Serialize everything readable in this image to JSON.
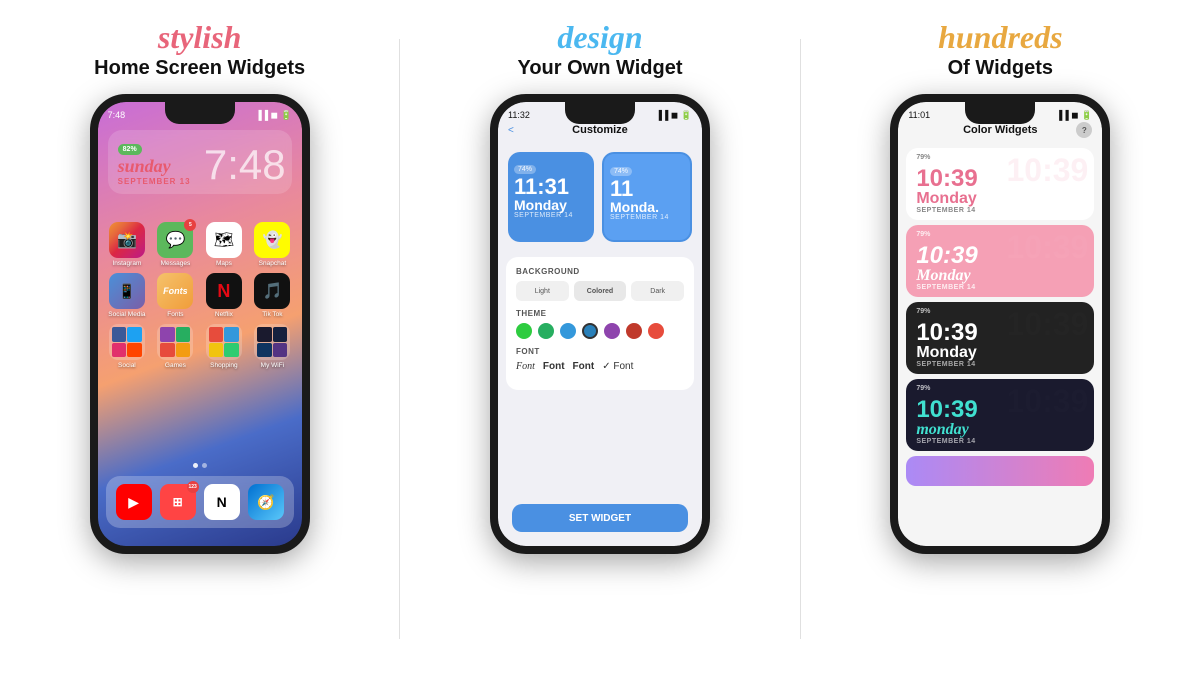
{
  "panels": [
    {
      "id": "panel1",
      "title_cursive": "stylish",
      "title_cursive_color": "pink",
      "title_bold": "Home Screen Widgets",
      "phone": {
        "time": "7:48",
        "status_left": "7:48",
        "status_right": "...",
        "battery": "82%",
        "clock_day": "sunday",
        "clock_time": "7:48",
        "clock_date": "SEPTEMBER 13",
        "apps": [
          {
            "name": "Instagram",
            "label": "Instagram",
            "color": "insta",
            "icon": "📸"
          },
          {
            "name": "Messages",
            "label": "Messages",
            "color": "messages",
            "icon": "💬",
            "badge": "5"
          },
          {
            "name": "Maps",
            "label": "Maps",
            "color": "maps",
            "icon": "🗺"
          },
          {
            "name": "Snapchat",
            "label": "Snapchat",
            "color": "snap",
            "icon": "👻"
          },
          {
            "name": "Social",
            "label": "Social Media",
            "color": "social",
            "icon": "📱"
          },
          {
            "name": "Fonts",
            "label": "Fonts",
            "color": "fonts-app",
            "icon": "Fon"
          },
          {
            "name": "Netflix",
            "label": "Netflix",
            "color": "netflix",
            "icon": "N"
          },
          {
            "name": "TikTok",
            "label": "Tik Tok",
            "color": "tiktok",
            "icon": "♪"
          }
        ],
        "dock": [
          {
            "name": "YouTube",
            "color": "youtube",
            "icon": "▶"
          },
          {
            "name": "Shortcut",
            "color": "shortcut",
            "icon": "⊞"
          },
          {
            "name": "Notion",
            "color": "notion",
            "icon": "N"
          },
          {
            "name": "Safari",
            "color": "safari",
            "icon": "🧭"
          }
        ]
      }
    },
    {
      "id": "panel2",
      "title_cursive": "design",
      "title_cursive_color": "blue",
      "title_bold": "Your Own Widget",
      "phone": {
        "time": "11:32",
        "nav_back": "<",
        "nav_title": "Customize",
        "widgets": [
          {
            "battery": "74%",
            "time": "11:31",
            "day": "Monday",
            "date": "SEPTEMBER 14"
          },
          {
            "battery": "74%",
            "time": "11",
            "day": "Monda.",
            "date": "SEPTEMBER 14"
          }
        ],
        "background_label": "BACKGROUND",
        "background_options": [
          "Light",
          "Colored",
          "Dark"
        ],
        "theme_label": "THEME",
        "theme_colors": [
          "#2ecc40",
          "#27ae60",
          "#3498db",
          "#2980b9",
          "#8e44ad",
          "#c0392b",
          "#e74c3c"
        ],
        "font_label": "FONT",
        "font_options": [
          "Font",
          "Font",
          "Font",
          "✓ Font"
        ],
        "set_widget_label": "SET WIDGET"
      }
    },
    {
      "id": "panel3",
      "title_cursive": "hundreds",
      "title_cursive_color": "gold",
      "title_bold": "Of Widgets",
      "phone": {
        "time": "11:01",
        "nav_title": "Color Widgets",
        "help_icon": "?",
        "widgets": [
          {
            "style": "light",
            "battery": "79%",
            "time": "10:39",
            "day": "Monday",
            "date": "SEPTEMBER 14"
          },
          {
            "style": "pink",
            "battery": "79%",
            "time": "10:39",
            "day": "Monday",
            "date": "SEPTEMBER 14"
          },
          {
            "style": "dark",
            "battery": "79%",
            "time": "10:39",
            "day": "Monday",
            "date": "SEPTEMBER 14"
          },
          {
            "style": "teal",
            "battery": "79%",
            "time": "10:39",
            "day": "monday",
            "date": "SEPTEMBER 14"
          }
        ]
      }
    }
  ]
}
